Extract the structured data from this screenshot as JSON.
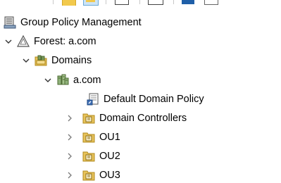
{
  "tree": {
    "root": {
      "label": "Group Policy Management",
      "icon": "gpmc-console-icon"
    },
    "forest": {
      "label": "Forest: a.com",
      "icon": "forest-icon",
      "expanded": true
    },
    "domains": {
      "label": "Domains",
      "icon": "domains-folder-icon",
      "expanded": true
    },
    "domain": {
      "label": "a.com",
      "icon": "domain-icon",
      "expanded": true
    },
    "children": [
      {
        "label": "Default Domain Policy",
        "icon": "gpo-link-icon",
        "expandable": false
      },
      {
        "label": "Domain Controllers",
        "icon": "ou-icon",
        "expandable": true
      },
      {
        "label": "OU1",
        "icon": "ou-icon",
        "expandable": true
      },
      {
        "label": "OU2",
        "icon": "ou-icon",
        "expandable": true
      },
      {
        "label": "OU3",
        "icon": "ou-icon",
        "expandable": true
      }
    ]
  },
  "colors": {
    "ou_folder": "#e8c35a",
    "ou_folder_dark": "#b08a1e",
    "chevron": "#7a7a7a",
    "chevron_expanded": "#333333"
  }
}
